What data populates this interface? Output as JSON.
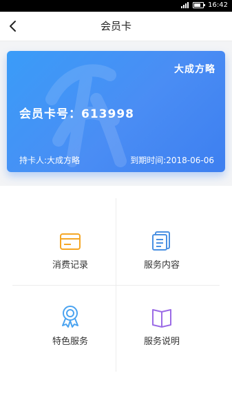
{
  "status_bar": {
    "time": "16:42"
  },
  "nav": {
    "title": "会员卡"
  },
  "card": {
    "brand": "大成方略",
    "number_label": "会员卡号：",
    "number": "613998",
    "holder": "持卡人:大成方略",
    "expiry": "到期时间:2018-06-06"
  },
  "menu": [
    {
      "label": "消费记录",
      "icon": "card-icon",
      "color": "#f5a623"
    },
    {
      "label": "服务内容",
      "icon": "document-icon",
      "color": "#4a90e2"
    },
    {
      "label": "特色服务",
      "icon": "badge-icon",
      "color": "#4aa3f0"
    },
    {
      "label": "服务说明",
      "icon": "book-icon",
      "color": "#9b6be6"
    }
  ]
}
